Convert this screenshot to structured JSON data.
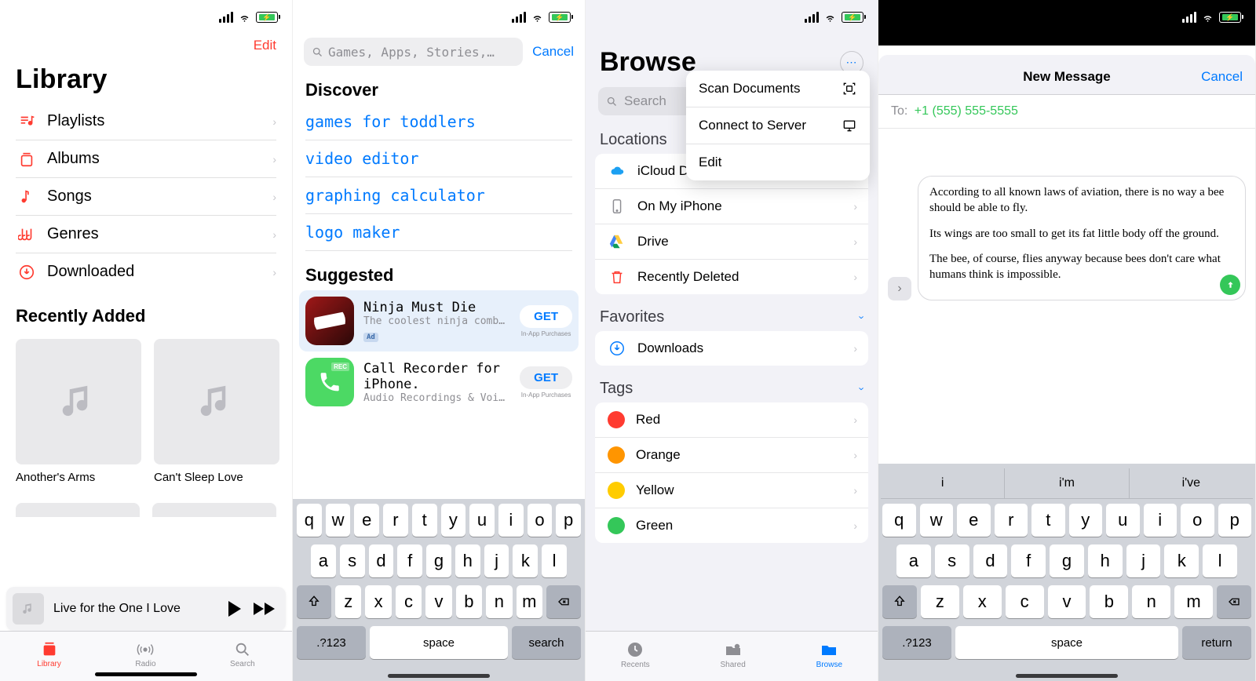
{
  "panel1": {
    "edit": "Edit",
    "title": "Library",
    "items": [
      {
        "label": "Playlists"
      },
      {
        "label": "Albums"
      },
      {
        "label": "Songs"
      },
      {
        "label": "Genres"
      },
      {
        "label": "Downloaded"
      }
    ],
    "recently_added": "Recently Added",
    "albums": [
      {
        "title": "Another's Arms"
      },
      {
        "title": "Can't Sleep Love"
      }
    ],
    "now_playing": "Live for the One I Love",
    "tabs": [
      {
        "label": "Library"
      },
      {
        "label": "Radio"
      },
      {
        "label": "Search"
      }
    ]
  },
  "panel2": {
    "search_placeholder": "Games, Apps, Stories,…",
    "cancel": "Cancel",
    "discover": "Discover",
    "discover_items": [
      "games for toddlers",
      "video editor",
      "graphing calculator",
      "logo maker"
    ],
    "suggested": "Suggested",
    "apps": [
      {
        "name": "Ninja Must Die",
        "sub": "The coolest ninja combat…",
        "ad": "Ad",
        "get": "GET",
        "iap": "In-App\nPurchases"
      },
      {
        "name": "Call Recorder for iPhone.",
        "sub": "Audio Recordings & Voice…",
        "get": "GET",
        "iap": "In-App\nPurchases"
      }
    ],
    "keyboard": {
      "row1": [
        "q",
        "w",
        "e",
        "r",
        "t",
        "y",
        "u",
        "i",
        "o",
        "p"
      ],
      "row2": [
        "a",
        "s",
        "d",
        "f",
        "g",
        "h",
        "j",
        "k",
        "l"
      ],
      "row3": [
        "z",
        "x",
        "c",
        "v",
        "b",
        "n",
        "m"
      ],
      "num": ".?123",
      "space": "space",
      "action": "search"
    }
  },
  "panel3": {
    "title": "Browse",
    "search": "Search",
    "menu": [
      {
        "label": "Scan Documents"
      },
      {
        "label": "Connect to Server"
      },
      {
        "label": "Edit"
      }
    ],
    "locations_h": "Locations",
    "locations": [
      {
        "label": "iCloud Drive"
      },
      {
        "label": "On My iPhone"
      },
      {
        "label": "Drive"
      },
      {
        "label": "Recently Deleted"
      }
    ],
    "favorites_h": "Favorites",
    "favorites": [
      {
        "label": "Downloads"
      }
    ],
    "tags_h": "Tags",
    "tags": [
      {
        "label": "Red",
        "color": "#ff3b30"
      },
      {
        "label": "Orange",
        "color": "#ff9500"
      },
      {
        "label": "Yellow",
        "color": "#ffcc00"
      },
      {
        "label": "Green",
        "color": "#34c759"
      }
    ],
    "tabs": [
      {
        "label": "Recents"
      },
      {
        "label": "Shared"
      },
      {
        "label": "Browse"
      }
    ]
  },
  "panel4": {
    "title": "New Message",
    "cancel": "Cancel",
    "to_label": "To:",
    "to_value": "+1 (555) 555-5555",
    "message_p1": "According to all known laws of aviation, there is no way a bee should be able to fly.",
    "message_p2": "Its wings are too small to get its fat little body off the ground.",
    "message_p3": "The bee, of course, flies anyway because bees don't care what humans think is impossible.",
    "predictions": [
      "i",
      "i'm",
      "i've"
    ],
    "keyboard": {
      "row1": [
        "q",
        "w",
        "e",
        "r",
        "t",
        "y",
        "u",
        "i",
        "o",
        "p"
      ],
      "row2": [
        "a",
        "s",
        "d",
        "f",
        "g",
        "h",
        "j",
        "k",
        "l"
      ],
      "row3": [
        "z",
        "x",
        "c",
        "v",
        "b",
        "n",
        "m"
      ],
      "num": ".?123",
      "space": "space",
      "action": "return"
    }
  }
}
